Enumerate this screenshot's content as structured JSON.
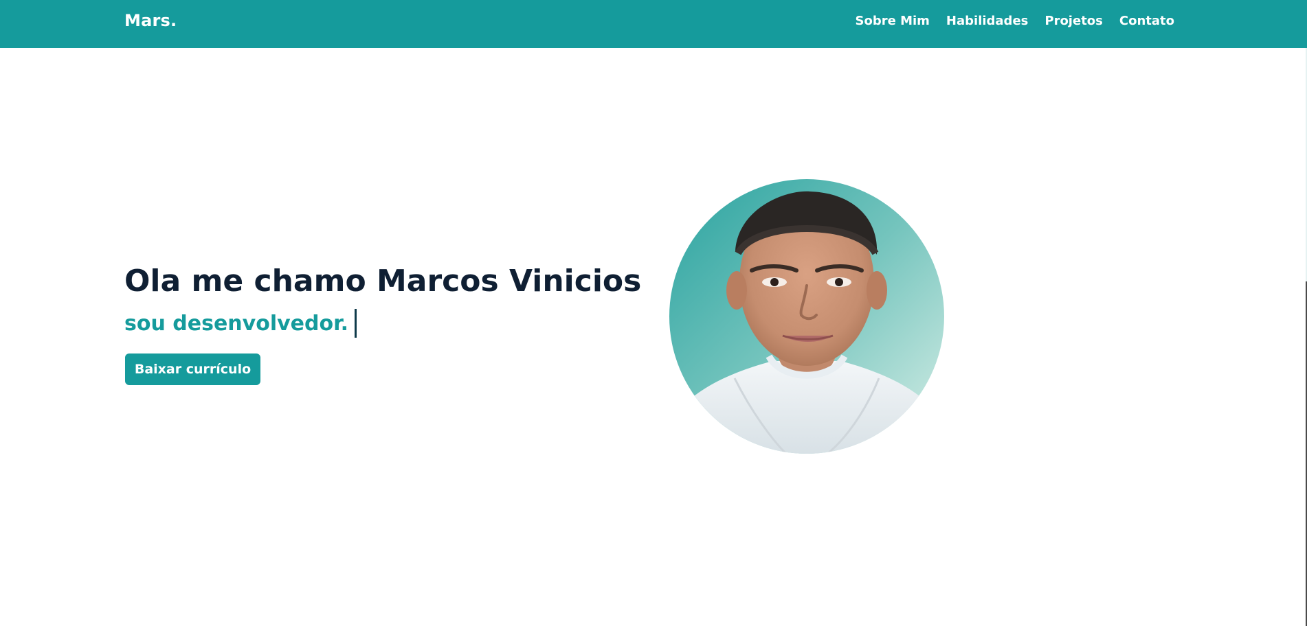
{
  "header": {
    "logo": "Mars.",
    "nav": [
      {
        "label": "Sobre Mim"
      },
      {
        "label": "Habilidades"
      },
      {
        "label": "Projetos"
      },
      {
        "label": "Contato"
      }
    ]
  },
  "hero": {
    "title": "Ola me chamo Marcos Vinicios",
    "subtitle": "sou desenvolvedor.",
    "button_label": "Baixar currículo"
  },
  "colors": {
    "brand": "#159b9c",
    "title_text": "#0f1f33",
    "background": "#ffffff"
  },
  "icons": {
    "profile_photo": "avatar"
  }
}
